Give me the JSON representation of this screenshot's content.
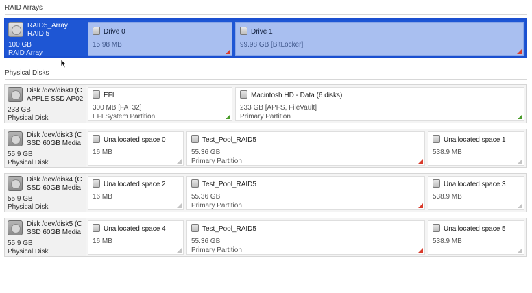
{
  "raid_section": {
    "title": "RAID Arrays",
    "array": {
      "name": "RAID5_Array",
      "level": "RAID 5",
      "size": "100 GB",
      "type": "RAID Array",
      "icon": "disk-icon",
      "drives": [
        {
          "name": "Drive 0",
          "size": "15.98 MB",
          "icon": "drive-icon",
          "corner_color": "#d93a2b"
        },
        {
          "name": "Drive 1",
          "size": "99.98 GB [BitLocker]",
          "icon": "drive-icon",
          "corner_color": "#d93a2b"
        }
      ]
    }
  },
  "physical_section": {
    "title": "Physical Disks",
    "disks": [
      {
        "name": "Disk /dev/disk0 (C",
        "model": "APPLE SSD AP02",
        "size": "233 GB",
        "type": "Physical Disk",
        "partitions": [
          {
            "name": "EFI",
            "size": "300 MB [FAT32]",
            "kind": "EFI System Partition",
            "corner_color": "#4a9c2b"
          },
          {
            "name": "Macintosh HD - Data (6 disks)",
            "size": "233 GB [APFS, FileVault]",
            "kind": "Primary Partition",
            "corner_color": "#4a9c2b"
          }
        ]
      },
      {
        "name": "Disk /dev/disk3 (C",
        "model": "SSD 60GB Media",
        "size": "55.9 GB",
        "type": "Physical Disk",
        "partitions": [
          {
            "name": "Unallocated space 0",
            "size": "16 MB",
            "kind": "",
            "corner_color": "#c4c4c4"
          },
          {
            "name": "Test_Pool_RAID5",
            "size": "55.36 GB",
            "kind": "Primary Partition",
            "corner_color": "#d93a2b"
          },
          {
            "name": "Unallocated space 1",
            "size": "538.9 MB",
            "kind": "",
            "corner_color": "#c4c4c4"
          }
        ]
      },
      {
        "name": "Disk /dev/disk4 (C",
        "model": "SSD 60GB Media",
        "size": "55.9 GB",
        "type": "Physical Disk",
        "partitions": [
          {
            "name": "Unallocated space 2",
            "size": "16 MB",
            "kind": "",
            "corner_color": "#c4c4c4"
          },
          {
            "name": "Test_Pool_RAID5",
            "size": "55.36 GB",
            "kind": "Primary Partition",
            "corner_color": "#d93a2b"
          },
          {
            "name": "Unallocated space 3",
            "size": "538.9 MB",
            "kind": "",
            "corner_color": "#c4c4c4"
          }
        ]
      },
      {
        "name": "Disk /dev/disk5 (C",
        "model": "SSD 60GB Media",
        "size": "55.9 GB",
        "type": "Physical Disk",
        "partitions": [
          {
            "name": "Unallocated space 4",
            "size": "16 MB",
            "kind": "",
            "corner_color": "#c4c4c4"
          },
          {
            "name": "Test_Pool_RAID5",
            "size": "55.36 GB",
            "kind": "Primary Partition",
            "corner_color": "#d93a2b"
          },
          {
            "name": "Unallocated space 5",
            "size": "538.9 MB",
            "kind": "",
            "corner_color": "#c4c4c4"
          }
        ]
      }
    ]
  },
  "colors": {
    "selection_blue": "#1e56d4",
    "selected_cell": "#a9bff0"
  }
}
